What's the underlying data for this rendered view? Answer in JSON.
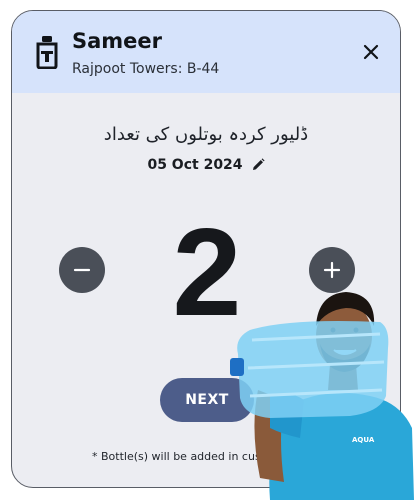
{
  "customer": {
    "name": "Sameer",
    "address": "Rajpoot Towers: B-44"
  },
  "main": {
    "label_urdu": "ڈلیور کردہ بوتلوں کی تعداد",
    "date": "05 Oct 2024",
    "count": "2",
    "next_label": "NEXT",
    "note": "* Bottle(s) will be added in custo"
  },
  "promo": {
    "shirt_text": "AQUA"
  },
  "colors": {
    "header_bg": "#d6e3fb",
    "card_bg": "#ecedf2",
    "round_button": "#4a4f58",
    "next_button": "#4d5d8a",
    "shirt": "#2aa7d8"
  },
  "icons": {
    "header": "water-bottle-icon",
    "close": "close-icon",
    "edit": "pencil-icon",
    "decrement": "minus-icon",
    "increment": "plus-icon"
  }
}
